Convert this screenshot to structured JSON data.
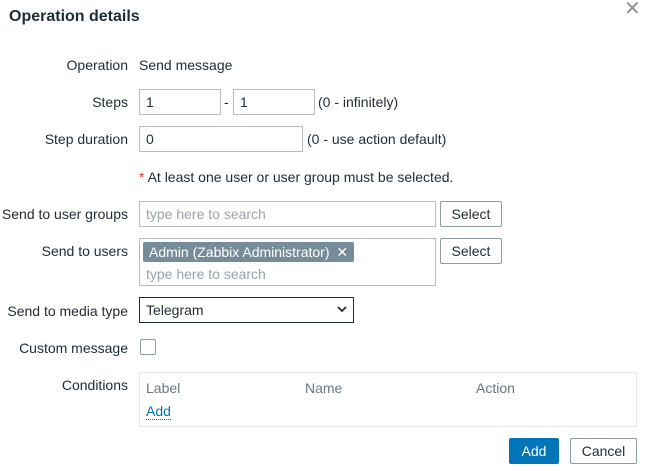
{
  "dialog": {
    "title": "Operation details",
    "close_icon": "close-icon"
  },
  "form": {
    "operation": {
      "label": "Operation",
      "value": "Send message"
    },
    "steps": {
      "label": "Steps",
      "from": "1",
      "separator": "-",
      "to": "1",
      "hint": "(0 - infinitely)"
    },
    "step_duration": {
      "label": "Step duration",
      "value": "0",
      "hint": "(0 - use action default)"
    },
    "requirement_note": {
      "asterisk": "*",
      "text": "At least one user or user group must be selected."
    },
    "user_groups": {
      "label": "Send to user groups",
      "placeholder": "type here to search",
      "button": "Select"
    },
    "users": {
      "label": "Send to users",
      "selected_tag": "Admin (Zabbix Administrator)",
      "tag_remove": "✕",
      "placeholder": "type here to search",
      "button": "Select"
    },
    "media_type": {
      "label": "Send to media type",
      "value": "Telegram"
    },
    "custom_message": {
      "label": "Custom message",
      "checked": false
    },
    "conditions": {
      "label": "Conditions",
      "columns": [
        "Label",
        "Name",
        "Action"
      ],
      "add_link": "Add"
    }
  },
  "footer": {
    "add_button": "Add",
    "cancel_button": "Cancel"
  },
  "colors": {
    "primary": "#0275b8",
    "tag": "#768d99",
    "required": "#e33734"
  }
}
